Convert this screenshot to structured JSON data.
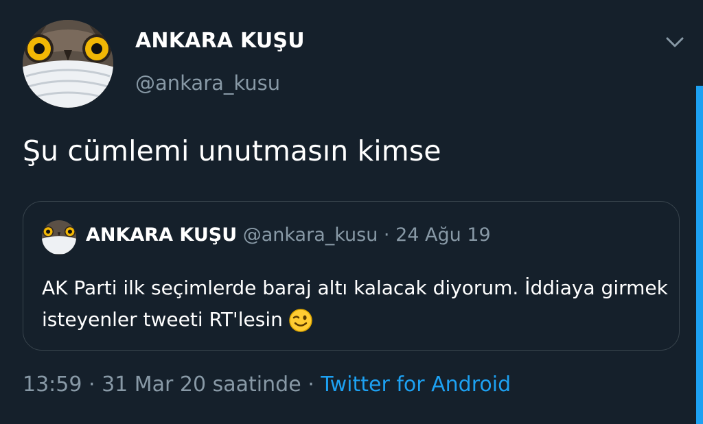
{
  "tweet": {
    "author_name": "ANKARA KUŞU",
    "author_handle": "@ankara_kusu",
    "text": "Şu cümlemi unutmasın kimse",
    "quoted": {
      "author_name": "ANKARA KUŞU",
      "author_handle": "@ankara_kusu",
      "separator": " · ",
      "date": "24 Ağu 19",
      "text": "AK Parti ilk seçimlerde baraj altı kalacak diyorum. İddiaya girmek isteyenler tweeti RT'lesin"
    },
    "footer": {
      "time": "13:59",
      "sep1": " · ",
      "date": "31 Mar 20 saatinde",
      "sep2": " · ",
      "source": "Twitter for Android"
    }
  },
  "icons": {
    "more": "chevron-down-icon",
    "emoji": "winking-face-icon"
  },
  "colors": {
    "background": "#15202b",
    "text_primary": "#ffffff",
    "text_secondary": "#8899a6",
    "accent": "#1da1f2",
    "border": "#38444d"
  }
}
